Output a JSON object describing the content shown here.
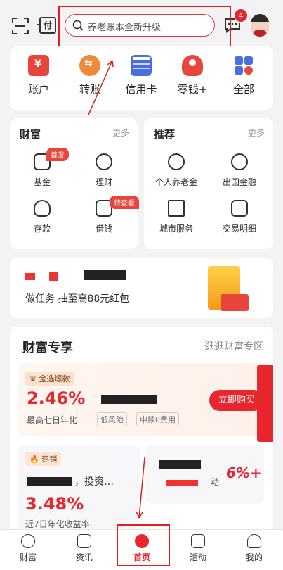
{
  "header": {
    "fu_label": "付",
    "search_placeholder": "养老账本全新升级",
    "message_count": "4"
  },
  "quick_menu": [
    {
      "label": "账户",
      "icon": "wallet-icon",
      "color": "#e8453c"
    },
    {
      "label": "转账",
      "icon": "transfer-icon",
      "color": "#f08a3a"
    },
    {
      "label": "信用卡",
      "icon": "credit-card-icon",
      "color": "#4a6ee0"
    },
    {
      "label": "零钱+",
      "icon": "piggy-bank-icon",
      "color": "#e8453c"
    },
    {
      "label": "全部",
      "icon": "grid-icon",
      "color": "#4a6ee0"
    }
  ],
  "wealth_card": {
    "title": "财富",
    "more": "更多",
    "items": [
      {
        "label": "基金",
        "tag": "首发"
      },
      {
        "label": "理财",
        "tag": ""
      },
      {
        "label": "存款",
        "tag": ""
      },
      {
        "label": "借钱",
        "tag": "待查看"
      }
    ]
  },
  "recommend_card": {
    "title": "推荐",
    "more": "更多",
    "items": [
      {
        "label": "个人养老金"
      },
      {
        "label": "出国金融"
      },
      {
        "label": "城市服务"
      },
      {
        "label": "交易明细"
      }
    ]
  },
  "banner": {
    "text": "做任务 抽至高88元红包"
  },
  "wealth_zone": {
    "title": "财富专享",
    "more": "逛逛财富专区",
    "featured": {
      "tag": "金选爆款",
      "rate": "2.46%",
      "rate_label": "最高七日年化",
      "chips": [
        "低风险",
        "申赎0费用"
      ],
      "button": "立即购买"
    },
    "hot": {
      "tag": "热销",
      "name_suffix": "，投资…",
      "rate": "3.48%",
      "rate_label": "近7日年化收益率"
    },
    "promo": {
      "text": "动",
      "percent": "6%+"
    }
  },
  "tabbar": [
    {
      "label": "财富",
      "icon": "wealth-icon",
      "active": false
    },
    {
      "label": "资讯",
      "icon": "news-icon",
      "active": false
    },
    {
      "label": "首页",
      "icon": "home-logo-icon",
      "active": true
    },
    {
      "label": "活动",
      "icon": "gift-icon",
      "active": false
    },
    {
      "label": "我的",
      "icon": "profile-icon",
      "active": false
    }
  ],
  "colors": {
    "accent": "#e8262d",
    "annotation": "#e02020"
  }
}
